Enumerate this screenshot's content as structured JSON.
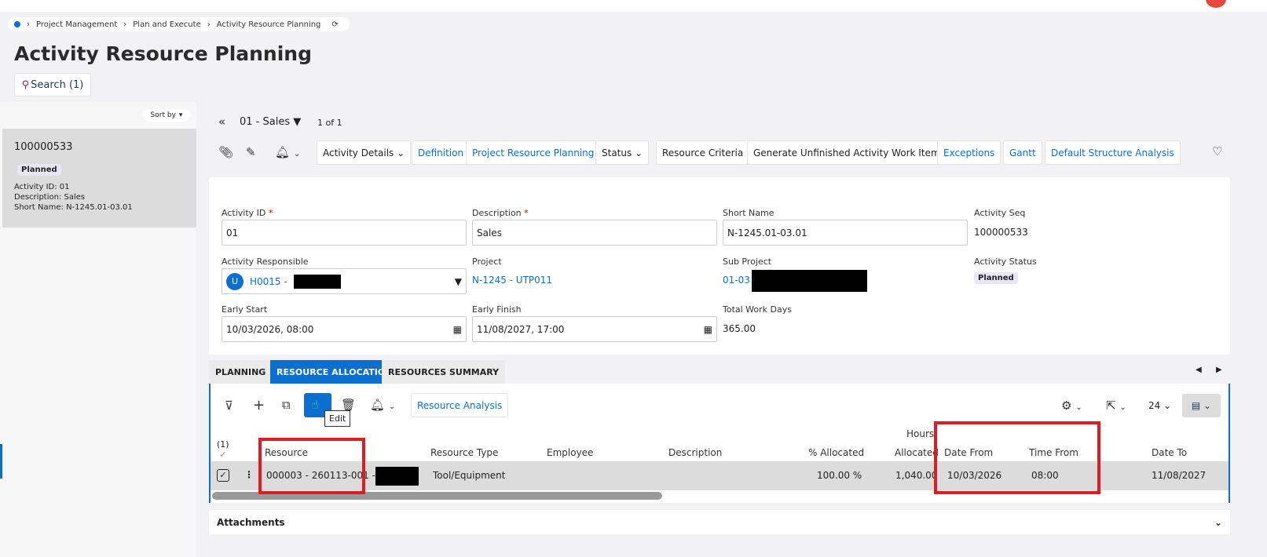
{
  "breadcrumb": [
    "Project Management",
    "Plan and Execute",
    "Activity Resource Planning"
  ],
  "page_title": "Activity Resource Planning",
  "search_label": "Search (1)",
  "sort_label": "Sort by",
  "list_card": {
    "id": "100000533",
    "status": "Planned",
    "activity_id": "Activity ID:  01",
    "description": "Description:  Sales",
    "short_name": "Short Name:  N-1245.01-03.01"
  },
  "nav": {
    "record": "01 - Sales",
    "count": "1 of 1"
  },
  "toolbar": [
    "Activity Details",
    "Definition",
    "Project Resource Planning",
    "Status",
    "Resource Criteria",
    "Generate Unfinished Activity Work Items",
    "Exceptions",
    "Gantt",
    "Default Structure Analysis"
  ],
  "form": {
    "activity_id_label": "Activity ID",
    "activity_id": "01",
    "description_label": "Description",
    "description": "Sales",
    "short_name_label": "Short Name",
    "short_name": "N-1245.01-03.01",
    "activity_seq_label": "Activity Seq",
    "activity_seq": "100000533",
    "responsible_label": "Activity Responsible",
    "responsible": "H0015 -",
    "responsible_avatar": "U",
    "project_label": "Project",
    "project": "N-1245 - UTP011",
    "sub_project_label": "Sub Project",
    "sub_project": "01-03",
    "status_label": "Activity Status",
    "status": "Planned",
    "early_start_label": "Early Start",
    "early_start": "10/03/2026, 08:00",
    "early_finish_label": "Early Finish",
    "early_finish": "11/08/2027, 17:00",
    "total_days_label": "Total Work Days",
    "total_days": "365.00"
  },
  "tabs": [
    "PLANNING",
    "RESOURCE ALLOCATION",
    "RESOURCES SUMMARY"
  ],
  "grid": {
    "resource_analysis": "Resource Analysis",
    "tooltip": "Edit",
    "page_size": "24",
    "selected": "(1)",
    "columns": [
      "Resource",
      "Resource Type",
      "Employee",
      "Description",
      "% Allocated",
      "Hours",
      "Allocated",
      "Date From",
      "Time From",
      "Date To"
    ],
    "row": {
      "resource": "000003 - 260113-001 -",
      "type": "Tool/Equipment",
      "employee": "",
      "description": "",
      "allocated": "100.00 %",
      "hours": "1,040.00",
      "date_from": "10/03/2026",
      "time_from": "08:00",
      "date_to": "11/08/2027"
    }
  },
  "attachments": "Attachments",
  "colors": {
    "accent": "#0b6fd0",
    "highlight": "#e01b24"
  }
}
